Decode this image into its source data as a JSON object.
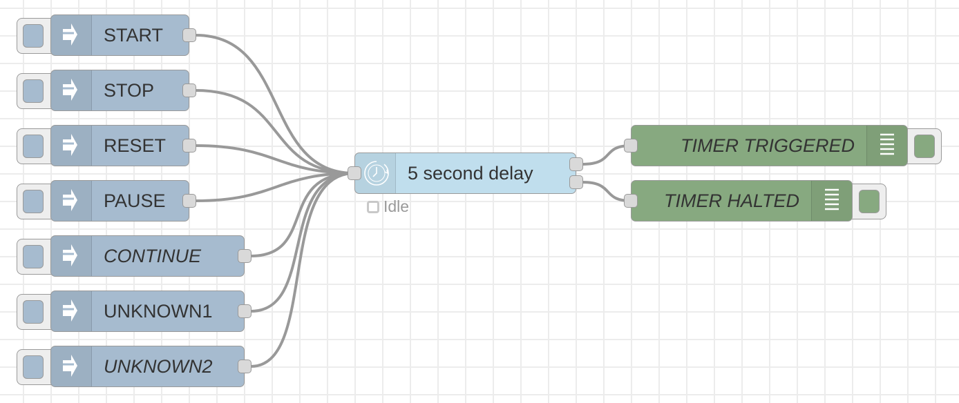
{
  "canvas": {
    "grid_color": "#ececec",
    "wire_color": "#999999"
  },
  "inject_nodes": [
    {
      "id": "start",
      "label": "START",
      "italic": false
    },
    {
      "id": "stop",
      "label": "STOP",
      "italic": false
    },
    {
      "id": "reset",
      "label": "RESET",
      "italic": false
    },
    {
      "id": "pause",
      "label": "PAUSE",
      "italic": false
    },
    {
      "id": "continue",
      "label": "CONTINUE",
      "italic": true
    },
    {
      "id": "unknown1",
      "label": "UNKNOWN1",
      "italic": false
    },
    {
      "id": "unknown2",
      "label": "UNKNOWN2",
      "italic": true
    }
  ],
  "delay_node": {
    "label": "5 second delay",
    "icon": "timer-icon",
    "status": "Idle",
    "outputs": 2
  },
  "debug_nodes": [
    {
      "id": "triggered",
      "label": "TIMER TRIGGERED",
      "italic": true
    },
    {
      "id": "halted",
      "label": "TIMER HALTED",
      "italic": true
    }
  ],
  "colors": {
    "inject": "#a6bbcf",
    "delay": "#c0deed",
    "debug": "#87a980"
  }
}
